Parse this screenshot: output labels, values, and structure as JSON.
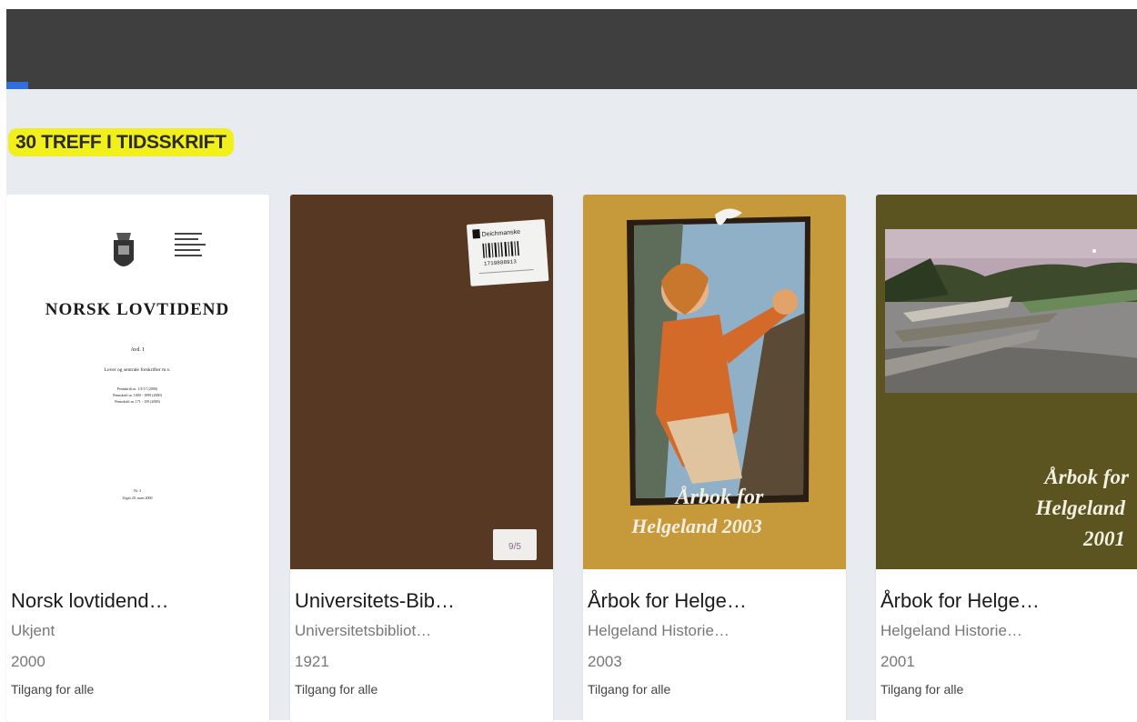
{
  "results": {
    "heading": "30 TREFF I TIDSSKRIFT"
  },
  "cards": [
    {
      "title": "Norsk lovtidend…",
      "publisher": "Ukjent",
      "year": "2000",
      "access": "Tilgang for alle",
      "cover": {
        "masthead": "NORSK LOVTIDEND",
        "section": "Avd. I",
        "subtitle": "Lover og sentrale forskrifter m.v.",
        "lines": [
          "Pennskrift nr. 1/3/17 (2000)",
          "Pennskrift nr. 1000 - 1099 (2000)",
          "Pennskrift nr. 171 - 159 (2000)"
        ],
        "issue_no": "Nr. 3",
        "issue_date": "Utgitt 20. mars 2000",
        "colors": {
          "bg": "#ffffff",
          "ink": "#1a1a1a"
        }
      }
    },
    {
      "title": "Universitets-Bib…",
      "publisher": "Universitetsbibliot…",
      "year": "1921",
      "access": "Tilgang for alle",
      "cover": {
        "label_title": "Deichmanske",
        "label_number": "1719888913",
        "corner_tag": "9/5",
        "colors": {
          "bg": "#5a3a24"
        }
      }
    },
    {
      "title": "Årbok for Helge…",
      "publisher": "Helgeland Historie…",
      "year": "2003",
      "access": "Tilgang for alle",
      "cover": {
        "line1": "Årbok for",
        "line2": "Helgeland 2003",
        "colors": {
          "bg": "#c69a3a",
          "text": "#f3efe2"
        }
      }
    },
    {
      "title": "Årbok for Helge…",
      "publisher": "Helgeland Historie…",
      "year": "2001",
      "access": "Tilgang for alle",
      "cover": {
        "line1": "Årbok for",
        "line2": "Helgeland",
        "line3": "2001",
        "colors": {
          "bg": "#5b5421",
          "text": "#f3f0e0"
        }
      }
    }
  ]
}
